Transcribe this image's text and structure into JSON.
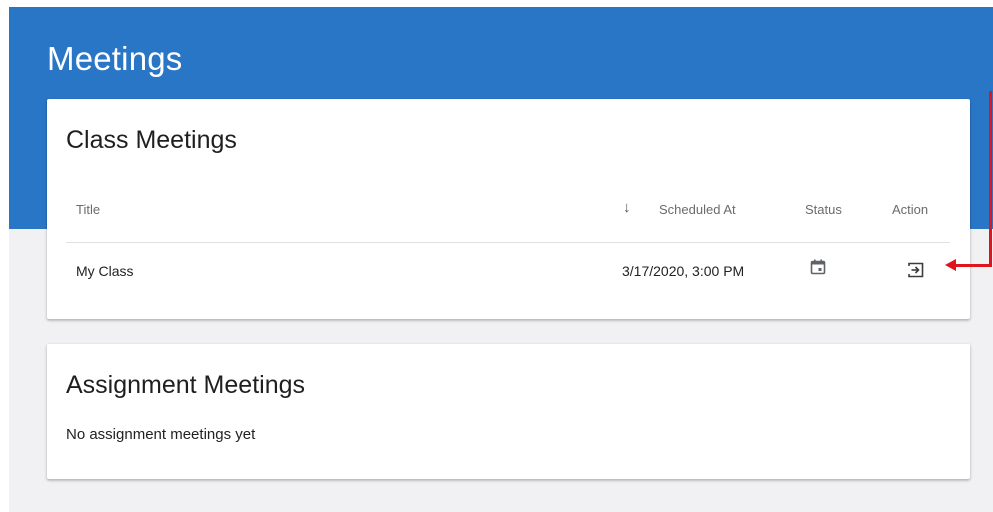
{
  "header": {
    "title": "Meetings"
  },
  "class_meetings": {
    "title": "Class Meetings",
    "columns": {
      "title": "Title",
      "sort_indicator": "↓",
      "scheduled_at": "Scheduled At",
      "status": "Status",
      "action": "Action"
    },
    "rows": [
      {
        "title": "My Class",
        "scheduled_at": "3/17/2020, 3:00 PM",
        "status_icon": "calendar-icon",
        "action_icon": "enter-meeting-icon"
      }
    ]
  },
  "assignment_meetings": {
    "title": "Assignment Meetings",
    "empty_text": "No assignment meetings yet"
  },
  "colors": {
    "header_bg": "#2a76c6",
    "page_bg": "#f1f1f4",
    "card_bg": "#ffffff",
    "annotation_arrow": "#e0141c"
  }
}
